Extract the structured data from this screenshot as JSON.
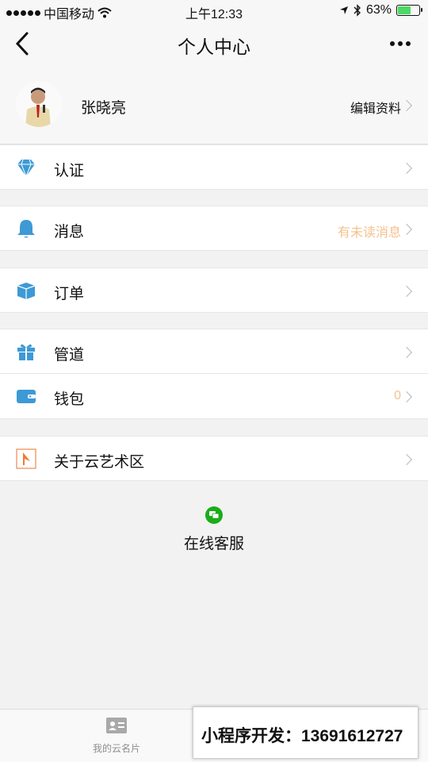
{
  "status_bar": {
    "carrier": "中国移动",
    "time": "上午12:33",
    "battery_percent": "63%",
    "battery_level": 0.63,
    "icons": [
      "signal-dots-icon",
      "wifi-icon",
      "location-arrow-icon",
      "bluetooth-icon",
      "battery-icon"
    ]
  },
  "nav": {
    "title": "个人中心",
    "back_icon": "chevron-left-icon",
    "more_icon": "more-dots-icon"
  },
  "profile": {
    "name": "张晓亮",
    "edit_label": "编辑资料"
  },
  "menu": [
    {
      "label": "认证",
      "icon": "diamond-icon",
      "value": "",
      "color": "#3d9ad5"
    },
    {
      "label": "消息",
      "icon": "bell-icon",
      "value": "有未读消息",
      "color": "#3d9ad5"
    },
    {
      "label": "订单",
      "icon": "box-icon",
      "value": "",
      "color": "#3d9ad5"
    },
    {
      "label": "管道",
      "icon": "gift-icon",
      "value": "",
      "color": "#3d9ad5"
    },
    {
      "label": "钱包",
      "icon": "wallet-icon",
      "value": "0",
      "color": "#3d9ad5"
    },
    {
      "label": "关于云艺术区",
      "icon": "flag-logo-icon",
      "value": "",
      "color": "#f07b30"
    }
  ],
  "service": {
    "label": "在线客服",
    "icon": "chat-bubble-icon"
  },
  "tabbar": {
    "items": [
      {
        "label": "我的云名片",
        "icon": "card-icon"
      }
    ]
  },
  "overlay": {
    "text": "小程序开发：13691612727"
  },
  "colors": {
    "accent": "#3d9ad5",
    "value_text": "#f5c28d",
    "service_green": "#1aad19",
    "background": "#f2f2f2"
  }
}
